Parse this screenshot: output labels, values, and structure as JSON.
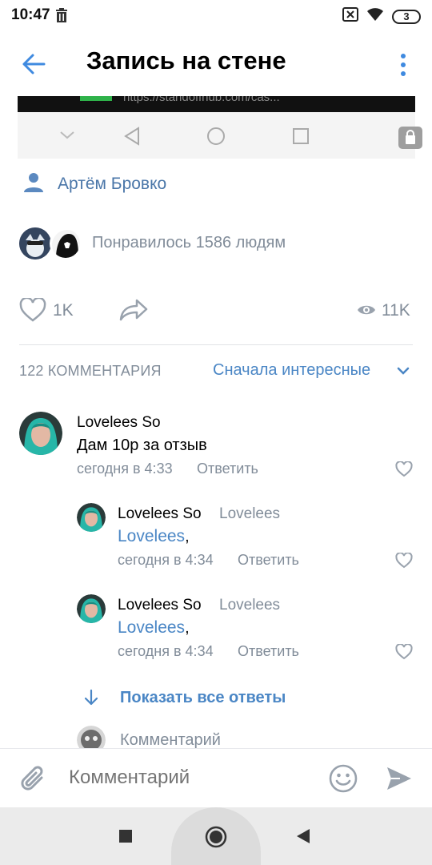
{
  "status_bar": {
    "time": "10:47",
    "battery": "3"
  },
  "header": {
    "title": "Запись на стене"
  },
  "embedded": {
    "url_fragment": "https://standoffhub.com/cas..."
  },
  "author": {
    "name": "Артём Бровко"
  },
  "likes": {
    "text": "Понравилось 1586 людям"
  },
  "actions": {
    "like_count": "1K",
    "views": "11K"
  },
  "comments_header": {
    "count_label": "122 КОММЕНТАРИЯ",
    "sort_label": "Сначала интересные"
  },
  "comments": [
    {
      "author": "Lovelees So",
      "text": "Дам 10р за отзыв",
      "time": "сегодня в 4:33",
      "reply": "Ответить"
    }
  ],
  "replies": [
    {
      "author": "Lovelees So",
      "reply_to": "Lovelees",
      "mention": "Lovelees",
      "suffix": ",",
      "time": "сегодня в 4:34",
      "reply": "Ответить"
    },
    {
      "author": "Lovelees So",
      "reply_to": "Lovelees",
      "mention": "Lovelees",
      "suffix": ",",
      "time": "сегодня в 4:34",
      "reply": "Ответить"
    }
  ],
  "show_all": "Показать все ответы",
  "partial_comment": "Комментарий",
  "composer": {
    "placeholder": "Комментарий"
  },
  "colors": {
    "accent": "#4a86c5",
    "author_blue": "#4a76a8",
    "secondary": "#818c99"
  }
}
